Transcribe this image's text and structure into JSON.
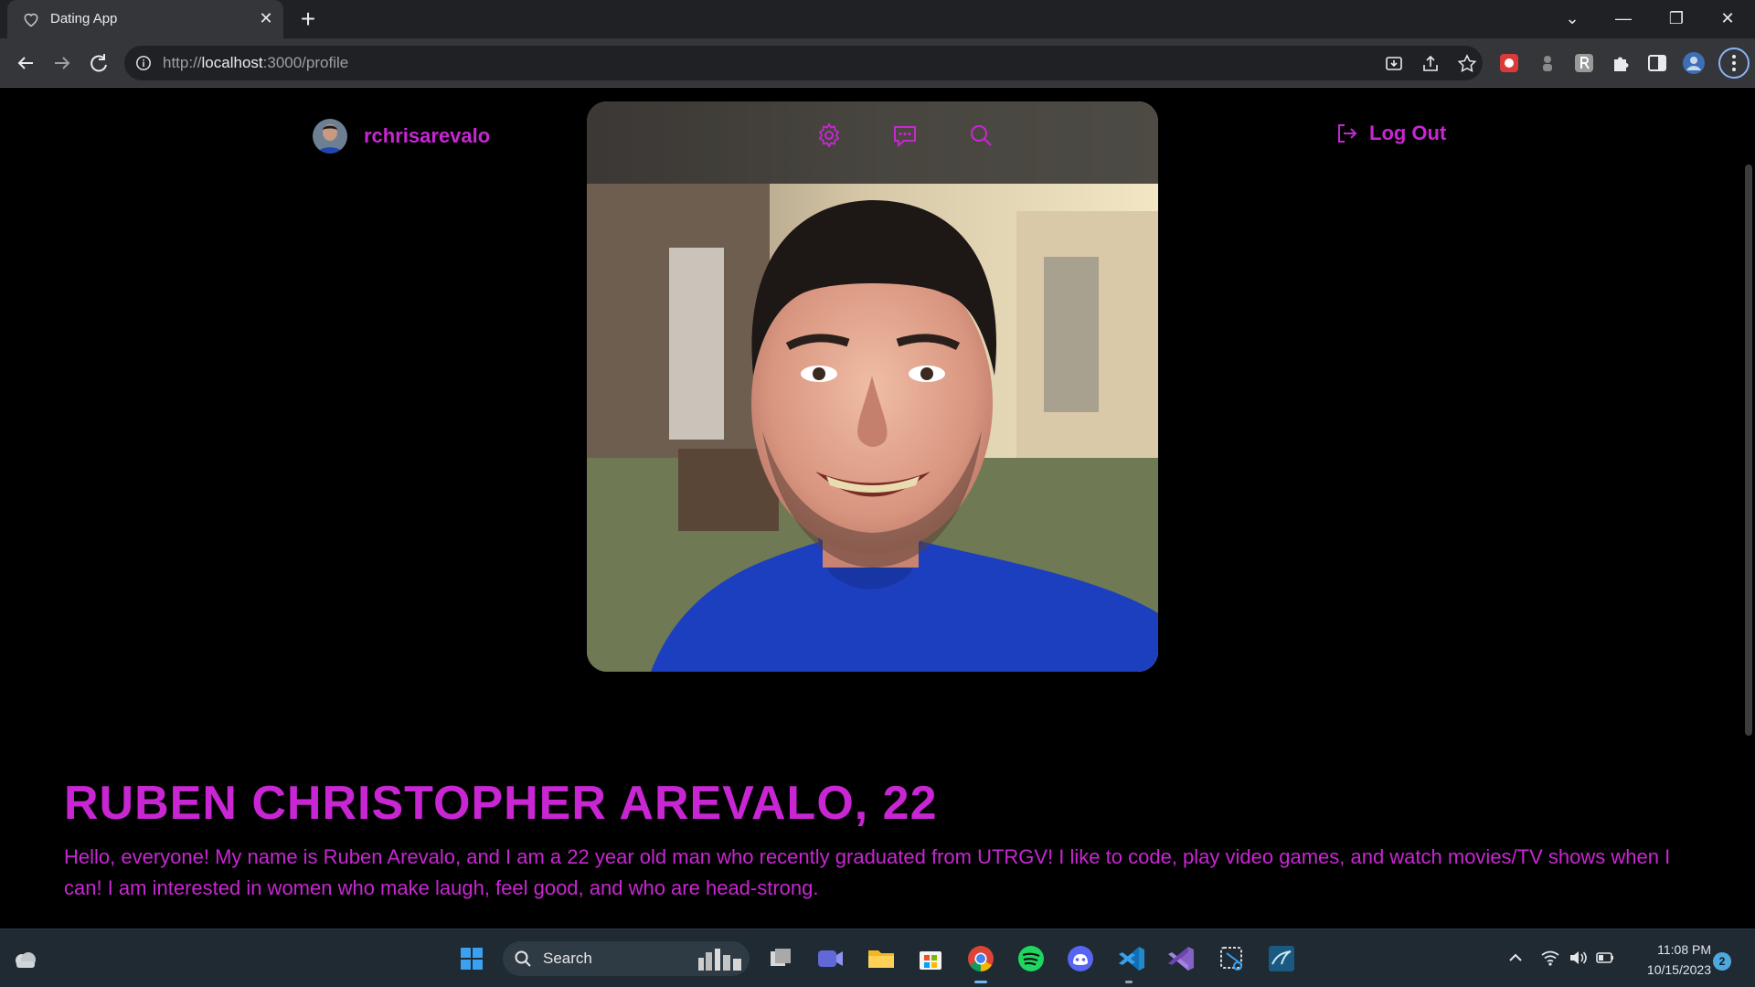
{
  "browser": {
    "tab_title": "Dating App",
    "tab_close": "✕",
    "new_tab": "+",
    "window_controls": [
      "⌄",
      "—",
      "❐",
      "✕"
    ],
    "url_scheme": "http://",
    "url_host": "localhost",
    "url_path": ":3000/profile"
  },
  "header": {
    "username": "rchrisarevalo",
    "logout_label": "Log Out"
  },
  "card_nav": [
    "settings-icon",
    "messages-icon",
    "search-icon"
  ],
  "profile": {
    "name": "RUBEN CHRISTOPHER AREVALO, 22",
    "bio": "Hello, everyone! My name is Ruben Arevalo, and I am a 22 year old man who recently graduated from UTRGV! I like to code, play video games, and watch movies/TV shows when I can! I am interested in women who make laugh, feel good, and who are head-strong."
  },
  "taskbar": {
    "search_label": "Search",
    "time": "11:08 PM",
    "date": "10/15/2023",
    "notification_count": "2"
  },
  "colors": {
    "accent": "#c926d3",
    "page_bg": "#000000"
  }
}
